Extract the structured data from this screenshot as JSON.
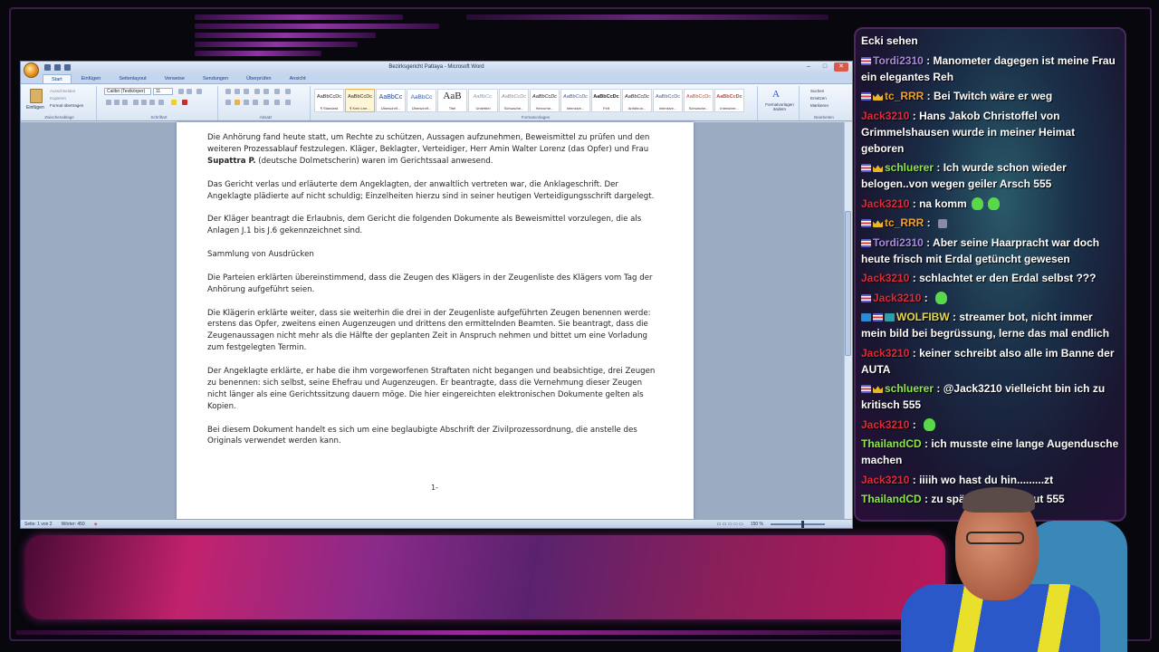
{
  "word": {
    "title": "Bezirksgericht Pattaya - Microsoft Word",
    "tabs": [
      "Start",
      "Einfügen",
      "Seitenlayout",
      "Verweise",
      "Sendungen",
      "Überprüfen",
      "Ansicht"
    ],
    "ribbon": {
      "paste_label": "Einfügen",
      "clipboard_items": [
        "Ausschneiden",
        "Kopieren",
        "Format übertragen"
      ],
      "font_name": "Calibri (Textkörper)",
      "font_size": "11",
      "group_labels": [
        "Zwischenablage",
        "Schriftart",
        "Absatz",
        "Formatvorlagen",
        "Bearbeiten"
      ],
      "styles": [
        {
          "sample": "AaBbCcDc",
          "name": "¶ Standard"
        },
        {
          "sample": "AaBbCcDc",
          "name": "¶ Kein Lee..."
        },
        {
          "sample": "AaBbCc",
          "name": "Überschrif..."
        },
        {
          "sample": "AaBbCc",
          "name": "Überschrif..."
        },
        {
          "sample": "AaB",
          "name": "Titel"
        },
        {
          "sample": "AaBbCc.",
          "name": "Untertitel"
        },
        {
          "sample": "AaBbCcDc",
          "name": "Schwache..."
        },
        {
          "sample": "AaBbCcDc",
          "name": "Hervorhe..."
        },
        {
          "sample": "AaBbCcDc",
          "name": "Intensive..."
        },
        {
          "sample": "AaBbCcDc",
          "name": "Fett"
        },
        {
          "sample": "AaBbCcDc",
          "name": "Anführun..."
        },
        {
          "sample": "AaBbCcDc",
          "name": "Intensive..."
        },
        {
          "sample": "AaBbCcDc",
          "name": "Schwache..."
        },
        {
          "sample": "AaBbCcDc",
          "name": "Intensiver..."
        }
      ],
      "change_styles": "Formatvorlagen ändern",
      "editing": [
        "Suchen",
        "Ersetzen",
        "Markieren"
      ]
    },
    "document": {
      "p1_a": "Die Anhörung fand heute statt, um Rechte zu schützen, Aussagen aufzunehmen, Beweismittel zu prüfen und den weiteren Prozessablauf festzulegen. Kläger, Beklagter, Verteidiger, Herr Amin Walter Lorenz (das Opfer) und Frau ",
      "p1_bold": "Supattra P.",
      "p1_b": " (deutsche Dolmetscherin) waren im Gerichtssaal anwesend.",
      "p2": "Das Gericht verlas und erläuterte dem Angeklagten, der anwaltlich vertreten war, die Anklageschrift. Der Angeklagte plädierte auf nicht schuldig; Einzelheiten hierzu sind in seiner heutigen Verteidigungsschrift dargelegt.",
      "p3": "Der Kläger beantragt die Erlaubnis, dem Gericht die folgenden Dokumente als Beweismittel vorzulegen, die als Anlagen J.1 bis J.6 gekennzeichnet sind.",
      "p4": "Sammlung von Ausdrücken",
      "p5": "Die Parteien erklärten übereinstimmend, dass die Zeugen des Klägers in der Zeugenliste des Klägers vom Tag der Anhörung aufgeführt seien.",
      "p6": "Die Klägerin erklärte weiter, dass sie weiterhin die drei in der Zeugenliste aufgeführten Zeugen benennen werde: erstens das Opfer, zweitens einen Augenzeugen und drittens den ermittelnden Beamten. Sie beantragt, dass die Zeugenaussagen nicht mehr als die Hälfte der geplanten Zeit in Anspruch nehmen und bittet um eine Vorladung zum festgelegten Termin.",
      "p7": "Der Angeklagte erklärte, er habe die ihm vorgeworfenen Straftaten nicht begangen und beabsichtige, drei Zeugen zu benennen: sich selbst, seine Ehefrau und Augenzeugen. Er beantragte, dass die Vernehmung dieser Zeugen nicht länger als eine Gerichtssitzung dauern möge. Die hier eingereichten elektronischen Dokumente gelten als Kopien.",
      "p8": "Bei diesem Dokument handelt es sich um eine beglaubigte Abschrift der Zivilprozessordnung, die anstelle des Originals verwendet werden kann.",
      "page_number": "1-"
    },
    "status": {
      "page": "Seite: 1 von 2",
      "words": "Wörter: 450",
      "zoom": "150 %"
    }
  },
  "chat": [
    {
      "user": "Ecki sehen",
      "color": "#ffffff",
      "badges": [],
      "text": ""
    },
    {
      "user": "Tordi2310",
      "color": "#a98ad8",
      "badges": [
        "flag"
      ],
      "text": "Manometer dagegen ist meine Frau ein elegantes Reh"
    },
    {
      "user": "tc_RRR",
      "color": "#f0a030",
      "badges": [
        "flag",
        "crown"
      ],
      "text": "Bei Twitch wäre er weg"
    },
    {
      "user": "Jack3210",
      "color": "#e02a3a",
      "badges": [],
      "text": "Hans Jakob Christoffel von Grimmelshausen wurde in meiner Heimat geboren"
    },
    {
      "user": "schluerer",
      "color": "#8ae84a",
      "badges": [
        "flag",
        "crown"
      ],
      "text": "Ich wurde schon wieder belogen..von wegen geiler Arsch 555"
    },
    {
      "user": "Jack3210",
      "color": "#e02a3a",
      "badges": [],
      "text": "na komm",
      "emotes": 2
    },
    {
      "user": "tc_RRR",
      "color": "#f0a030",
      "badges": [
        "flag",
        "crown"
      ],
      "text": "",
      "emote_small": true
    },
    {
      "user": "Tordi2310",
      "color": "#a98ad8",
      "badges": [
        "flag"
      ],
      "text": "Aber seine Haarpracht war doch heute frisch mit Erdal getüncht gewesen"
    },
    {
      "user": "Jack3210",
      "color": "#e02a3a",
      "badges": [],
      "text": "schlachtet er den Erdal selbst ???"
    },
    {
      "user": "Jack3210",
      "color": "#e02a3a",
      "badges": [
        "flag"
      ],
      "text": "",
      "emotes": 1
    },
    {
      "user": "WOLFIBW",
      "color": "#e8d84a",
      "badges": [
        "mod",
        "flag",
        "bot"
      ],
      "text": "streamer bot, nicht immer mein bild bei begrüssung, lerne das mal endlich"
    },
    {
      "user": "Jack3210",
      "color": "#e02a3a",
      "badges": [],
      "text": "keiner schreibt also alle im Banne der AUTA"
    },
    {
      "user": "schluerer",
      "color": "#8ae84a",
      "badges": [
        "flag",
        "crown"
      ],
      "text": "@Jack3210 vielleicht bin ich zu kritisch 555"
    },
    {
      "user": "Jack3210",
      "color": "#e02a3a",
      "badges": [],
      "text": "",
      "emotes": 1
    },
    {
      "user": "ThailandCD",
      "color": "#8ae84a",
      "badges": [],
      "text": "ich musste eine lange Augendusche machen"
    },
    {
      "user": "Jack3210",
      "color": "#e02a3a",
      "badges": [],
      "text": "iiiih wo hast du hin.........zt"
    },
    {
      "user": "ThailandCD",
      "color": "#8ae84a",
      "badges": [],
      "text": "zu spät weg geschaut 555"
    }
  ]
}
